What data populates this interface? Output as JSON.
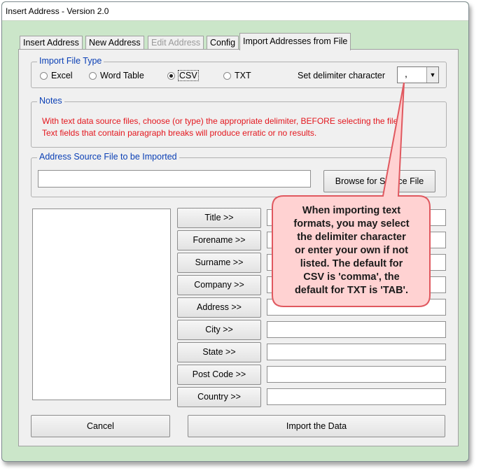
{
  "window": {
    "title": "Insert Address - Version 2.0"
  },
  "tabs": [
    {
      "label": "Insert Address",
      "state": "normal"
    },
    {
      "label": "New Address",
      "state": "normal"
    },
    {
      "label": "Edit Address",
      "state": "disabled"
    },
    {
      "label": "Config",
      "state": "normal"
    },
    {
      "label": "Import Addresses from File",
      "state": "active"
    }
  ],
  "import_type": {
    "legend": "Import File Type",
    "options": [
      "Excel",
      "Word Table",
      "CSV",
      "TXT"
    ],
    "selected": "CSV",
    "delimiter_label": "Set delimiter character",
    "delimiter_value": ","
  },
  "notes": {
    "legend": "Notes",
    "line1": "With text data source files, choose (or type) the appropriate delimiter, BEFORE selecting the file.",
    "line2": "Text fields that contain paragraph breaks will produce erratic or no results."
  },
  "source": {
    "legend": "Address Source File to be Imported",
    "path_value": "",
    "browse_label": "Browse for Source File"
  },
  "fields": [
    {
      "button": "Title >>",
      "value": ""
    },
    {
      "button": "Forename >>",
      "value": ""
    },
    {
      "button": "Surname >>",
      "value": ""
    },
    {
      "button": "Company >>",
      "value": ""
    },
    {
      "button": "Address >>",
      "value": ""
    },
    {
      "button": "City >>",
      "value": ""
    },
    {
      "button": "State >>",
      "value": ""
    },
    {
      "button": "Post Code >>",
      "value": ""
    },
    {
      "button": "Country >>",
      "value": ""
    }
  ],
  "actions": {
    "cancel_label": "Cancel",
    "import_label": "Import the Data"
  },
  "callout": {
    "line1": "When importing text",
    "line2": "formats, you may select",
    "line3": "the delimiter character",
    "line4": "or enter your own if not",
    "line5": "listed. The default for",
    "line6": "CSV is 'comma', the",
    "line7": "default for TXT is 'TAB'."
  },
  "colors": {
    "window_bg": "#cbe6c9",
    "notes_text": "#e3161d",
    "legend_text": "#0a3fb5",
    "callout_fill": "#ffd0d0",
    "callout_stroke": "#e0585f"
  }
}
